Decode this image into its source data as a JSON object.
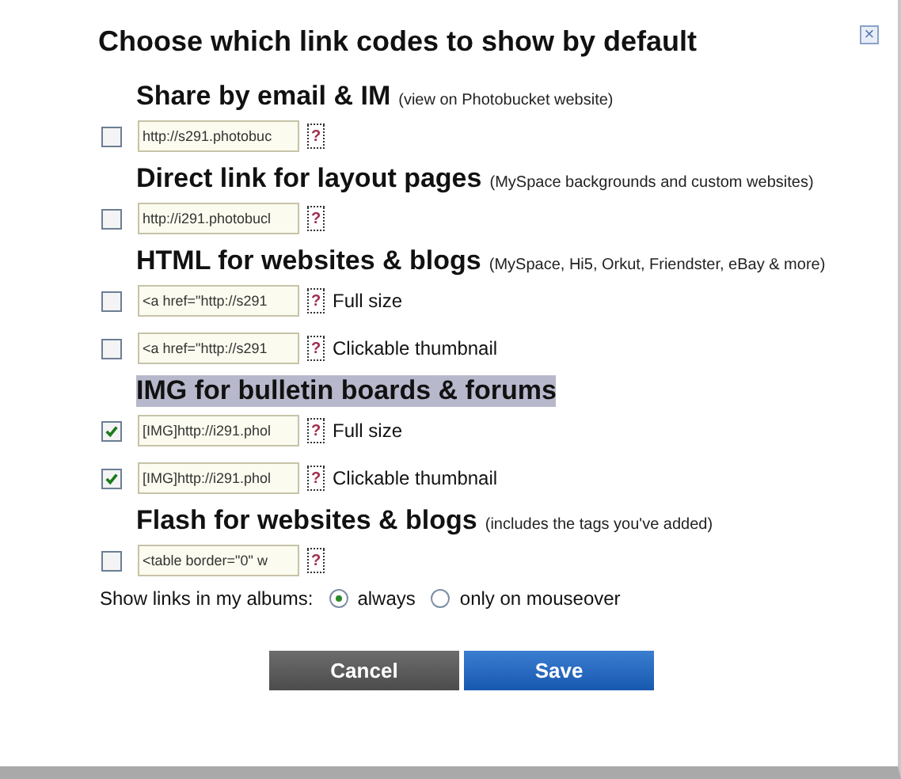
{
  "dialog": {
    "title": "Choose which link codes to show by default",
    "close": "×"
  },
  "sections": [
    {
      "heading": "Share by email & IM",
      "note": "(view on Photobucket website)",
      "highlighted": false,
      "options": [
        {
          "code": "http://s291.photobuc",
          "help": "?",
          "checked": false
        }
      ]
    },
    {
      "heading": "Direct link for layout pages",
      "note": "(MySpace backgrounds and custom websites)",
      "highlighted": false,
      "options": [
        {
          "code": "http://i291.photobucl",
          "help": "?",
          "checked": false
        }
      ]
    },
    {
      "heading": "HTML for websites & blogs",
      "note": "(MySpace, Hi5, Orkut, Friendster, eBay & more)",
      "highlighted": false,
      "options": [
        {
          "code": "<a href=\"http://s291",
          "help": "?",
          "checked": false,
          "label": "Full size"
        },
        {
          "code": "<a href=\"http://s291",
          "help": "?",
          "checked": false,
          "label": "Clickable thumbnail"
        }
      ]
    },
    {
      "heading": "IMG for bulletin boards & forums",
      "highlighted": true,
      "options": [
        {
          "code": "[IMG]http://i291.phol",
          "help": "?",
          "checked": true,
          "label": "Full size"
        },
        {
          "code": "[IMG]http://i291.phol",
          "help": "?",
          "checked": true,
          "label": "Clickable thumbnail"
        }
      ]
    },
    {
      "heading": "Flash for websites & blogs",
      "note": "(includes the tags you've added)",
      "highlighted": false,
      "options": [
        {
          "code": "<table border=\"0\" w",
          "help": "?",
          "checked": false
        }
      ]
    }
  ],
  "show_links": {
    "label": "Show links in my albums:",
    "options": [
      {
        "label": "always",
        "selected": true
      },
      {
        "label": "only on mouseover",
        "selected": false
      }
    ]
  },
  "buttons": [
    {
      "label": "Cancel",
      "kind": "secondary"
    },
    {
      "label": "Save",
      "kind": "primary"
    }
  ]
}
